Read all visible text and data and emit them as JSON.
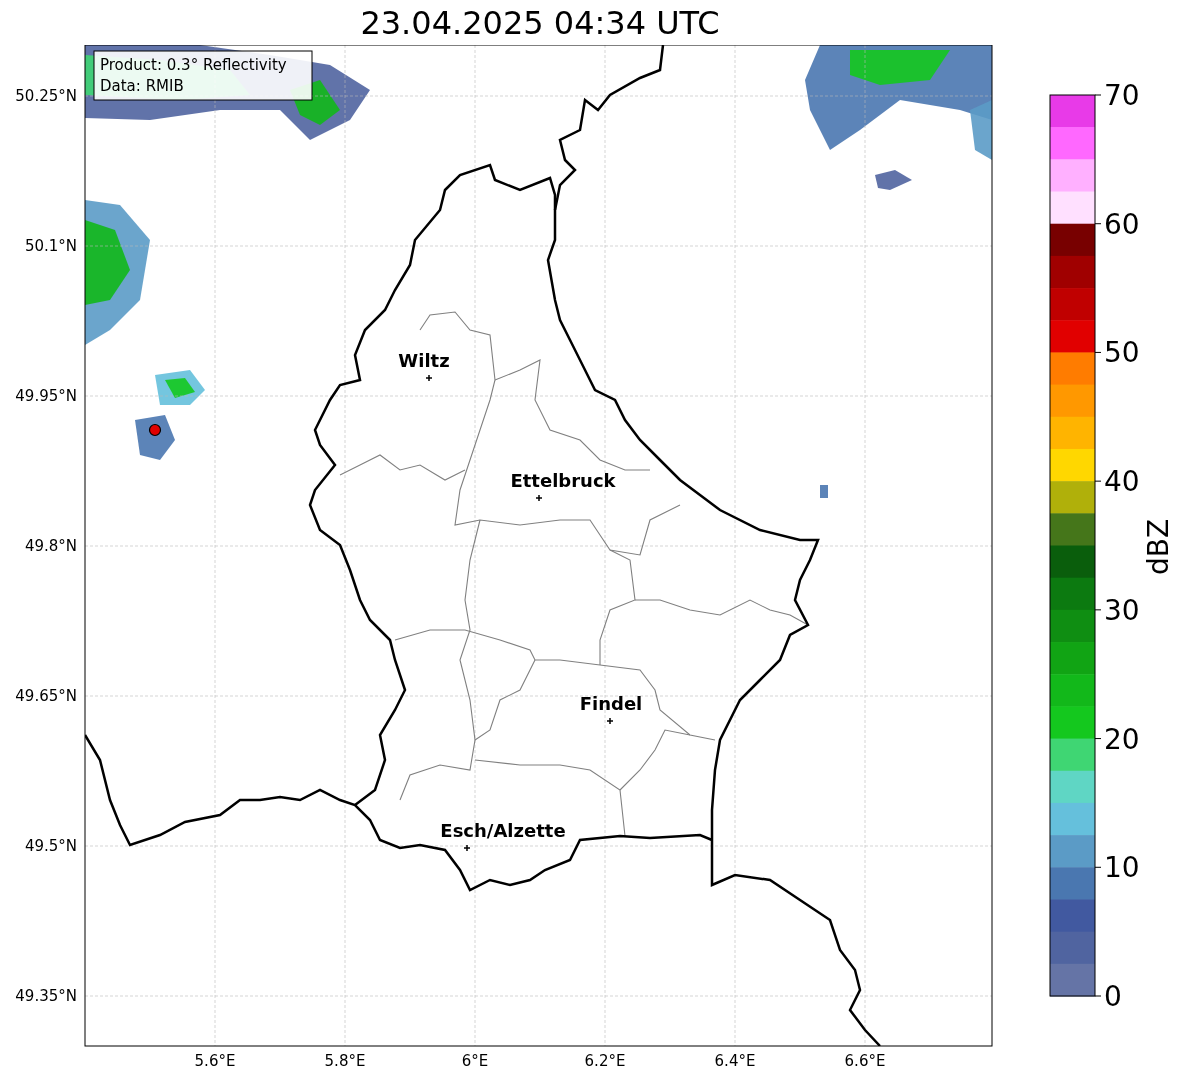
{
  "title": "23.04.2025 04:34 UTC",
  "legend": [
    "Product: 0.3° Reflectivity",
    "Data: RMIB"
  ],
  "lat_labels": [
    "50.25°N",
    "50.1°N",
    "49.95°N",
    "49.8°N",
    "49.65°N",
    "49.5°N",
    "49.35°N"
  ],
  "lon_labels": [
    "5.6°E",
    "5.8°E",
    "6°E",
    "6.2°E",
    "6.4°E",
    "6.6°E"
  ],
  "cities": [
    {
      "name": "Wiltz"
    },
    {
      "name": "Ettelbruck"
    },
    {
      "name": "Findel"
    },
    {
      "name": "Esch/Alzette"
    }
  ],
  "colorbar": {
    "label": "dBZ",
    "ticks": [
      "70",
      "60",
      "50",
      "40",
      "30",
      "20",
      "10",
      "0"
    ],
    "bins": [
      {
        "color": "#e83ae8"
      },
      {
        "color": "#ff68ff"
      },
      {
        "color": "#ffb0ff"
      },
      {
        "color": "#ffe0ff"
      },
      {
        "color": "#780000"
      },
      {
        "color": "#a00000"
      },
      {
        "color": "#c00000"
      },
      {
        "color": "#e10000"
      },
      {
        "color": "#ff7c00"
      },
      {
        "color": "#ff9800"
      },
      {
        "color": "#ffb400"
      },
      {
        "color": "#ffd700"
      },
      {
        "color": "#b0b00a"
      },
      {
        "color": "#45761a"
      },
      {
        "color": "#0a5e0c"
      },
      {
        "color": "#0c7a10"
      },
      {
        "color": "#0f8e12"
      },
      {
        "color": "#11a414"
      },
      {
        "color": "#12b81a"
      },
      {
        "color": "#14c81e"
      },
      {
        "color": "#3fd673"
      },
      {
        "color": "#5fd6c4"
      },
      {
        "color": "#65c0dc"
      },
      {
        "color": "#5b9bc6"
      },
      {
        "color": "#4a77b0"
      },
      {
        "color": "#4159a0"
      },
      {
        "color": "#5064a0"
      },
      {
        "color": "#6574a6"
      }
    ]
  }
}
